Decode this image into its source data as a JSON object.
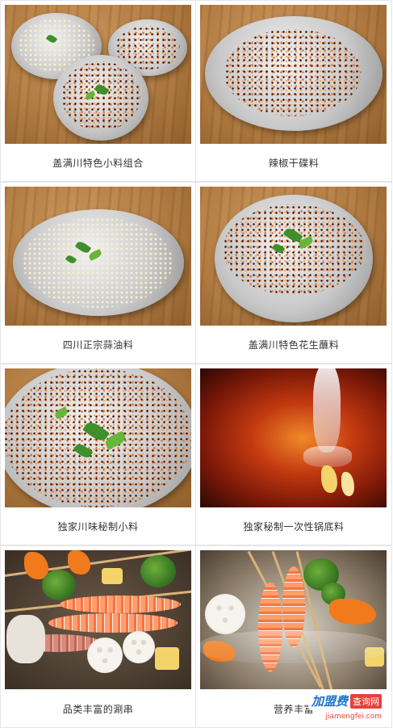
{
  "items": [
    {
      "caption": "盖满川特色小料组合",
      "image": "sauce-trio-photo"
    },
    {
      "caption": "辣椒干碟料",
      "image": "dry-chili-dip-photo"
    },
    {
      "caption": "四川正宗蒜油料",
      "image": "garlic-oil-photo"
    },
    {
      "caption": "盖满川特色花生蘸料",
      "image": "peanut-dip-photo"
    },
    {
      "caption": "独家川味秘制小料",
      "image": "secret-sauce-photo"
    },
    {
      "caption": "独家秘制一次性锅底料",
      "image": "hotpot-base-photo"
    },
    {
      "caption": "品类丰富的涮串",
      "image": "skewers-photo"
    },
    {
      "caption": "营养丰富",
      "image": "nutritious-skewers-photo"
    }
  ],
  "watermark": {
    "brand": "加盟费",
    "badge": "查询网",
    "url": "jiamengfei.com"
  }
}
